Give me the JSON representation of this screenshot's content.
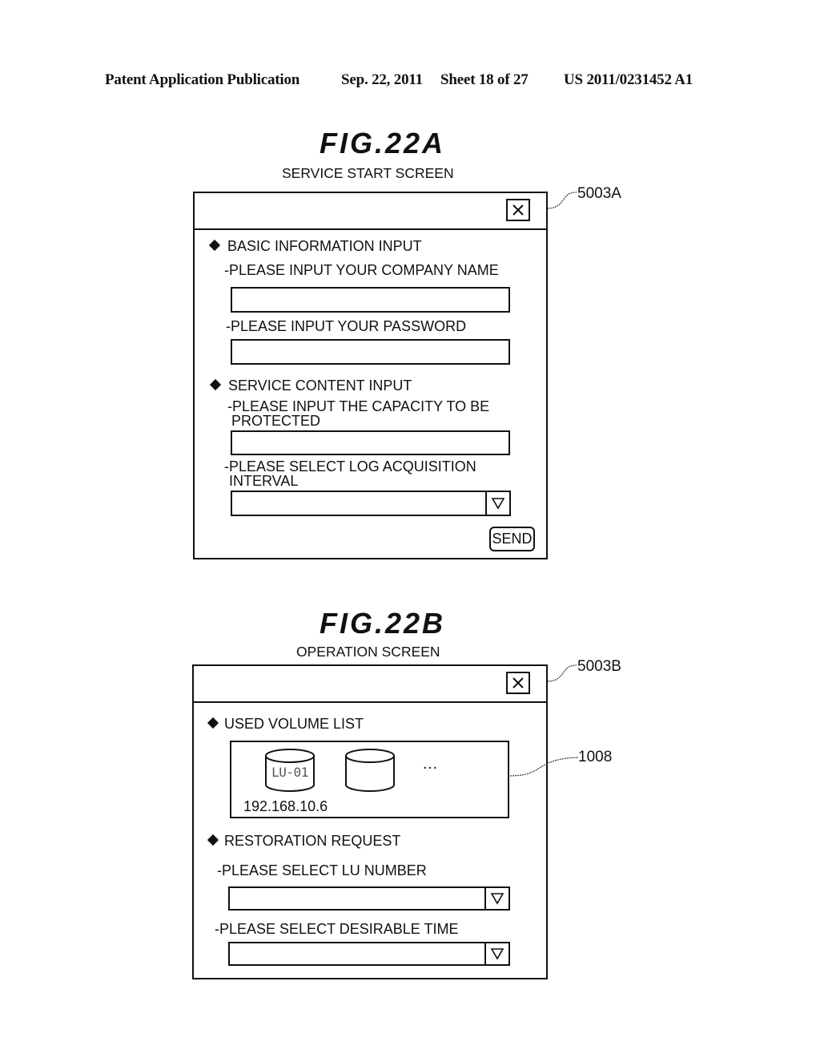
{
  "header": {
    "publication": "Patent Application Publication",
    "date": "Sep. 22, 2011",
    "sheet": "Sheet 18 of 27",
    "number": "US 2011/0231452 A1"
  },
  "fig_a": {
    "title": "FIG.22A",
    "caption": "SERVICE START SCREEN",
    "ref_label": "5003A",
    "close_icon": "close-icon",
    "sections": {
      "basic": {
        "heading": "BASIC INFORMATION INPUT",
        "company_label": "-PLEASE INPUT YOUR COMPANY NAME",
        "company_value": "",
        "password_label": "-PLEASE INPUT YOUR PASSWORD",
        "password_value": ""
      },
      "service": {
        "heading": "SERVICE CONTENT INPUT",
        "capacity_label_line1": "-PLEASE INPUT THE CAPACITY TO BE",
        "capacity_label_line2": "PROTECTED",
        "capacity_value": "",
        "interval_label_line1": "-PLEASE SELECT LOG ACQUISITION",
        "interval_label_line2": "INTERVAL",
        "interval_value": ""
      }
    },
    "send_label": "SEND"
  },
  "fig_b": {
    "title": "FIG.22B",
    "caption": "OPERATION SCREEN",
    "ref_label": "5003B",
    "volume_list": {
      "heading": "USED VOLUME LIST",
      "ref_label": "1008",
      "volumes": [
        {
          "label": "LU-01"
        },
        {
          "label": ""
        }
      ],
      "ellipsis": "…",
      "address": "192.168.10.6"
    },
    "restoration": {
      "heading": "RESTORATION REQUEST",
      "lu_label": "-PLEASE SELECT LU NUMBER",
      "lu_value": "",
      "time_label": "-PLEASE SELECT DESIRABLE TIME",
      "time_value": ""
    }
  }
}
